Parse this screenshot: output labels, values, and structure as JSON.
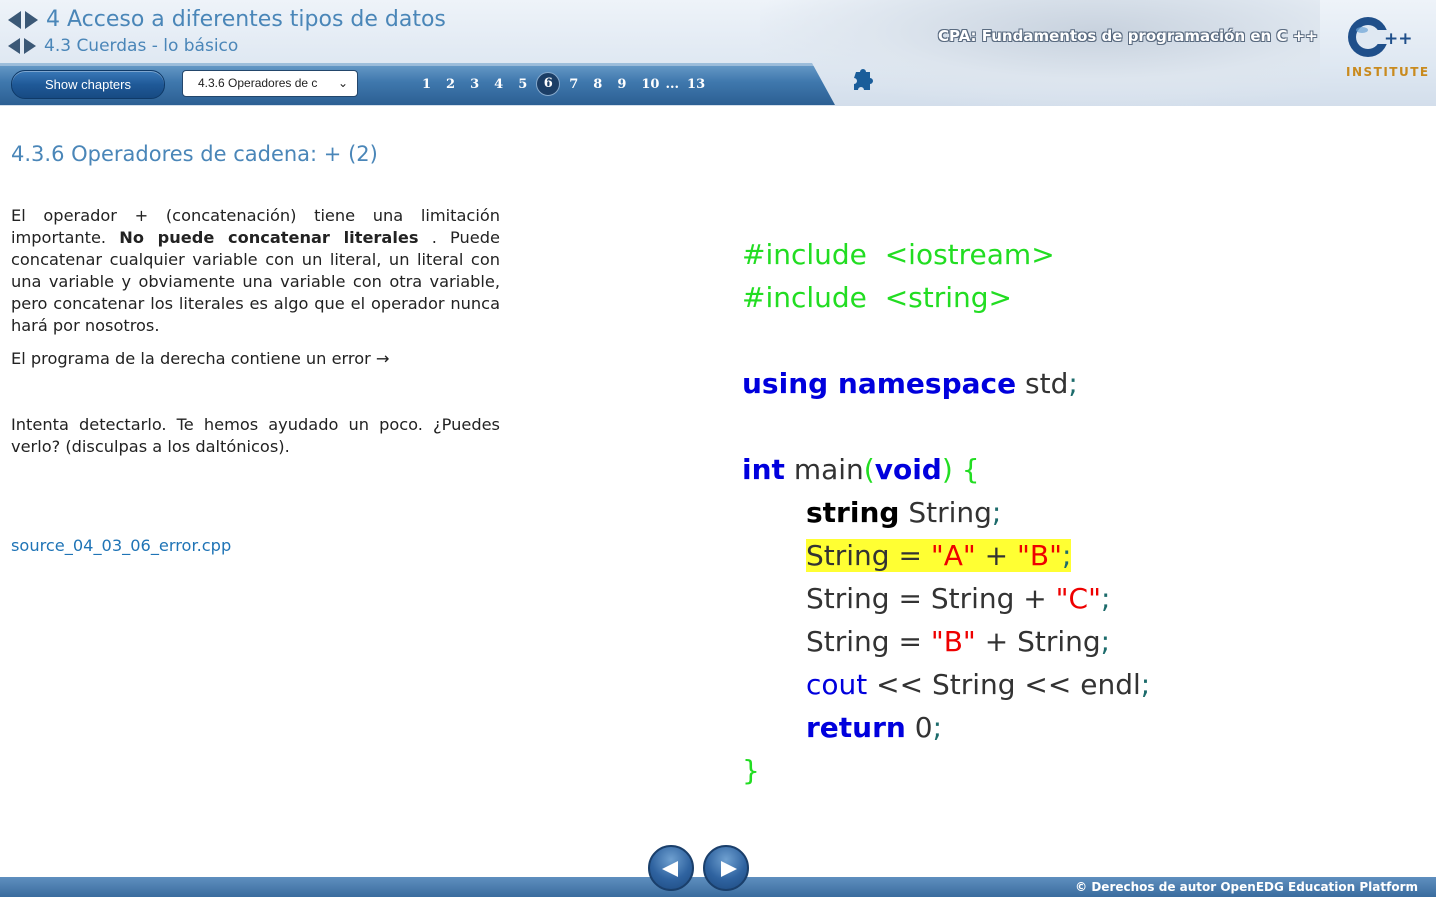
{
  "header": {
    "chapter_title": "4 Acceso a diferentes tipos de datos",
    "section_title": "4.3 Cuerdas - lo básico",
    "course_title": "CPA: Fundamentos de programación en C ++",
    "logo_text": "INSTITUTE",
    "logo_mark": "C++"
  },
  "toolbar": {
    "show_chapters_label": "Show chapters",
    "select_value": "4.3.6 Operadores de c",
    "pages": [
      "1",
      "2",
      "3",
      "4",
      "5",
      "6",
      "7",
      "8",
      "9",
      "10",
      "...",
      "13"
    ],
    "active_page": "6"
  },
  "content": {
    "page_title": "4.3.6 Operadores de cadena: + (2)",
    "p1_part1": "El operador + (concatenación) tiene una limitación importante. ",
    "p1_bold": "No puede concatenar literales",
    "p1_part2": " . Puede concatenar cualquier variable con un literal, un literal con una variable y obviamente una variable con otra variable, pero concatenar los literales es algo que el operador nunca hará por nosotros.",
    "p2": "El programa de la derecha contiene un error →",
    "p3": "Intenta detectarlo. Te hemos ayudado un poco. ¿Puedes verlo? (disculpas a los daltónicos).",
    "file_link": "source_04_03_06_error.cpp"
  },
  "code": {
    "include_1": "#include  <iostream>",
    "include_2": "#include  <string>",
    "using_kw": "using namespace",
    "std": " std",
    "int_kw": "int",
    "main": " main",
    "void_kw": "void",
    "string_kw": "string",
    "String_var": "String",
    "lit_A": "\"A\"",
    "lit_B": "\"B\"",
    "lit_C": "\"C\"",
    "eq": " = ",
    "plus": " + ",
    "cout": "cout",
    "stream": " << String << endl",
    "return_kw": "return",
    "zero": " 0",
    "semi": ";",
    "lparen": "(",
    "rparen": ")",
    "lbrace": " {",
    "rbrace": "}"
  },
  "footer": {
    "copyright": "© Derechos de autor OpenEDG Education Platform"
  },
  "colors": {
    "accent": "#4a86b8",
    "toolbar": "#2c5f93",
    "code_green": "#22dd22",
    "code_blue": "#0000dd",
    "code_red": "#ee0000",
    "highlight": "#ffff33"
  },
  "icons": [
    "arrow-left-icon",
    "arrow-right-icon",
    "puzzle-icon",
    "prev-icon",
    "next-icon",
    "chevron-down-icon"
  ]
}
